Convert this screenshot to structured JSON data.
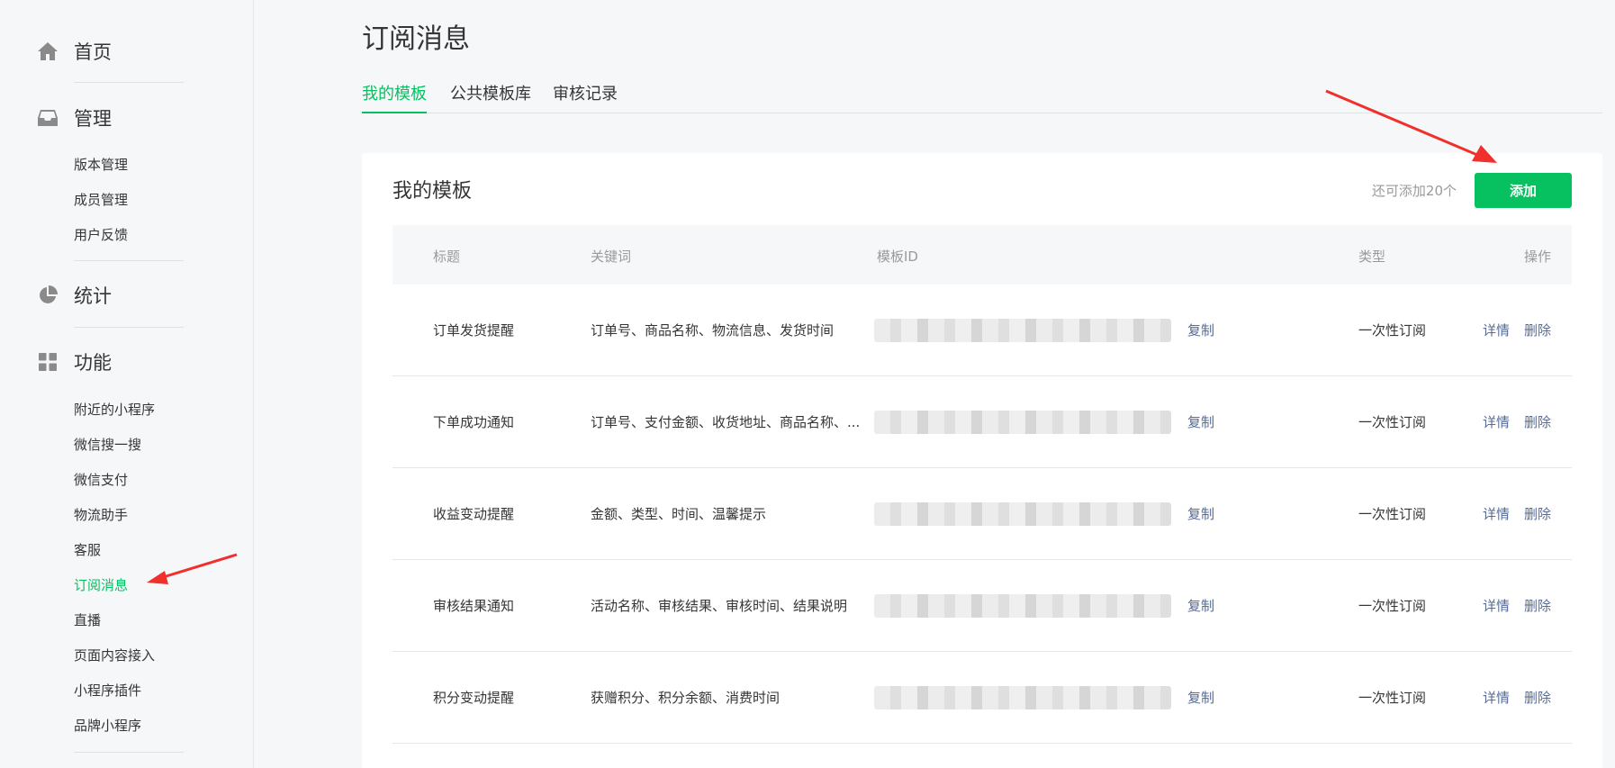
{
  "sidebar": {
    "home": {
      "label": "首页",
      "icon": "home-icon"
    },
    "manage": {
      "label": "管理",
      "icon": "inbox-icon",
      "items": [
        "版本管理",
        "成员管理",
        "用户反馈"
      ]
    },
    "stats": {
      "label": "统计",
      "icon": "pie-chart-icon"
    },
    "features": {
      "label": "功能",
      "icon": "grid-icon",
      "items": [
        "附近的小程序",
        "微信搜一搜",
        "微信支付",
        "物流助手",
        "客服",
        "订阅消息",
        "直播",
        "页面内容接入",
        "小程序插件",
        "品牌小程序"
      ],
      "active": "订阅消息"
    }
  },
  "page": {
    "title": "订阅消息",
    "tabs": [
      "我的模板",
      "公共模板库",
      "审核记录"
    ],
    "active_tab": "我的模板"
  },
  "card": {
    "title": "我的模板",
    "quota": "还可添加20个",
    "add_label": "添加"
  },
  "table": {
    "headers": {
      "title": "标题",
      "keywords": "关键词",
      "template_id": "模板ID",
      "type": "类型",
      "action": "操作"
    },
    "rows": [
      {
        "title": "订单发货提醒",
        "keywords": "订单号、商品名称、物流信息、发货时间",
        "copy": "复制",
        "type": "一次性订阅",
        "detail": "详情",
        "delete": "删除"
      },
      {
        "title": "下单成功通知",
        "keywords": "订单号、支付金额、收货地址、商品名称、...",
        "copy": "复制",
        "type": "一次性订阅",
        "detail": "详情",
        "delete": "删除"
      },
      {
        "title": "收益变动提醒",
        "keywords": "金额、类型、时间、温馨提示",
        "copy": "复制",
        "type": "一次性订阅",
        "detail": "详情",
        "delete": "删除"
      },
      {
        "title": "审核结果通知",
        "keywords": "活动名称、审核结果、审核时间、结果说明",
        "copy": "复制",
        "type": "一次性订阅",
        "detail": "详情",
        "delete": "删除"
      },
      {
        "title": "积分变动提醒",
        "keywords": "获赠积分、积分余额、消费时间",
        "copy": "复制",
        "type": "一次性订阅",
        "detail": "详情",
        "delete": "删除"
      }
    ]
  },
  "colors": {
    "accent": "#07c160",
    "link": "#576b95",
    "arrow": "#f0302c"
  }
}
